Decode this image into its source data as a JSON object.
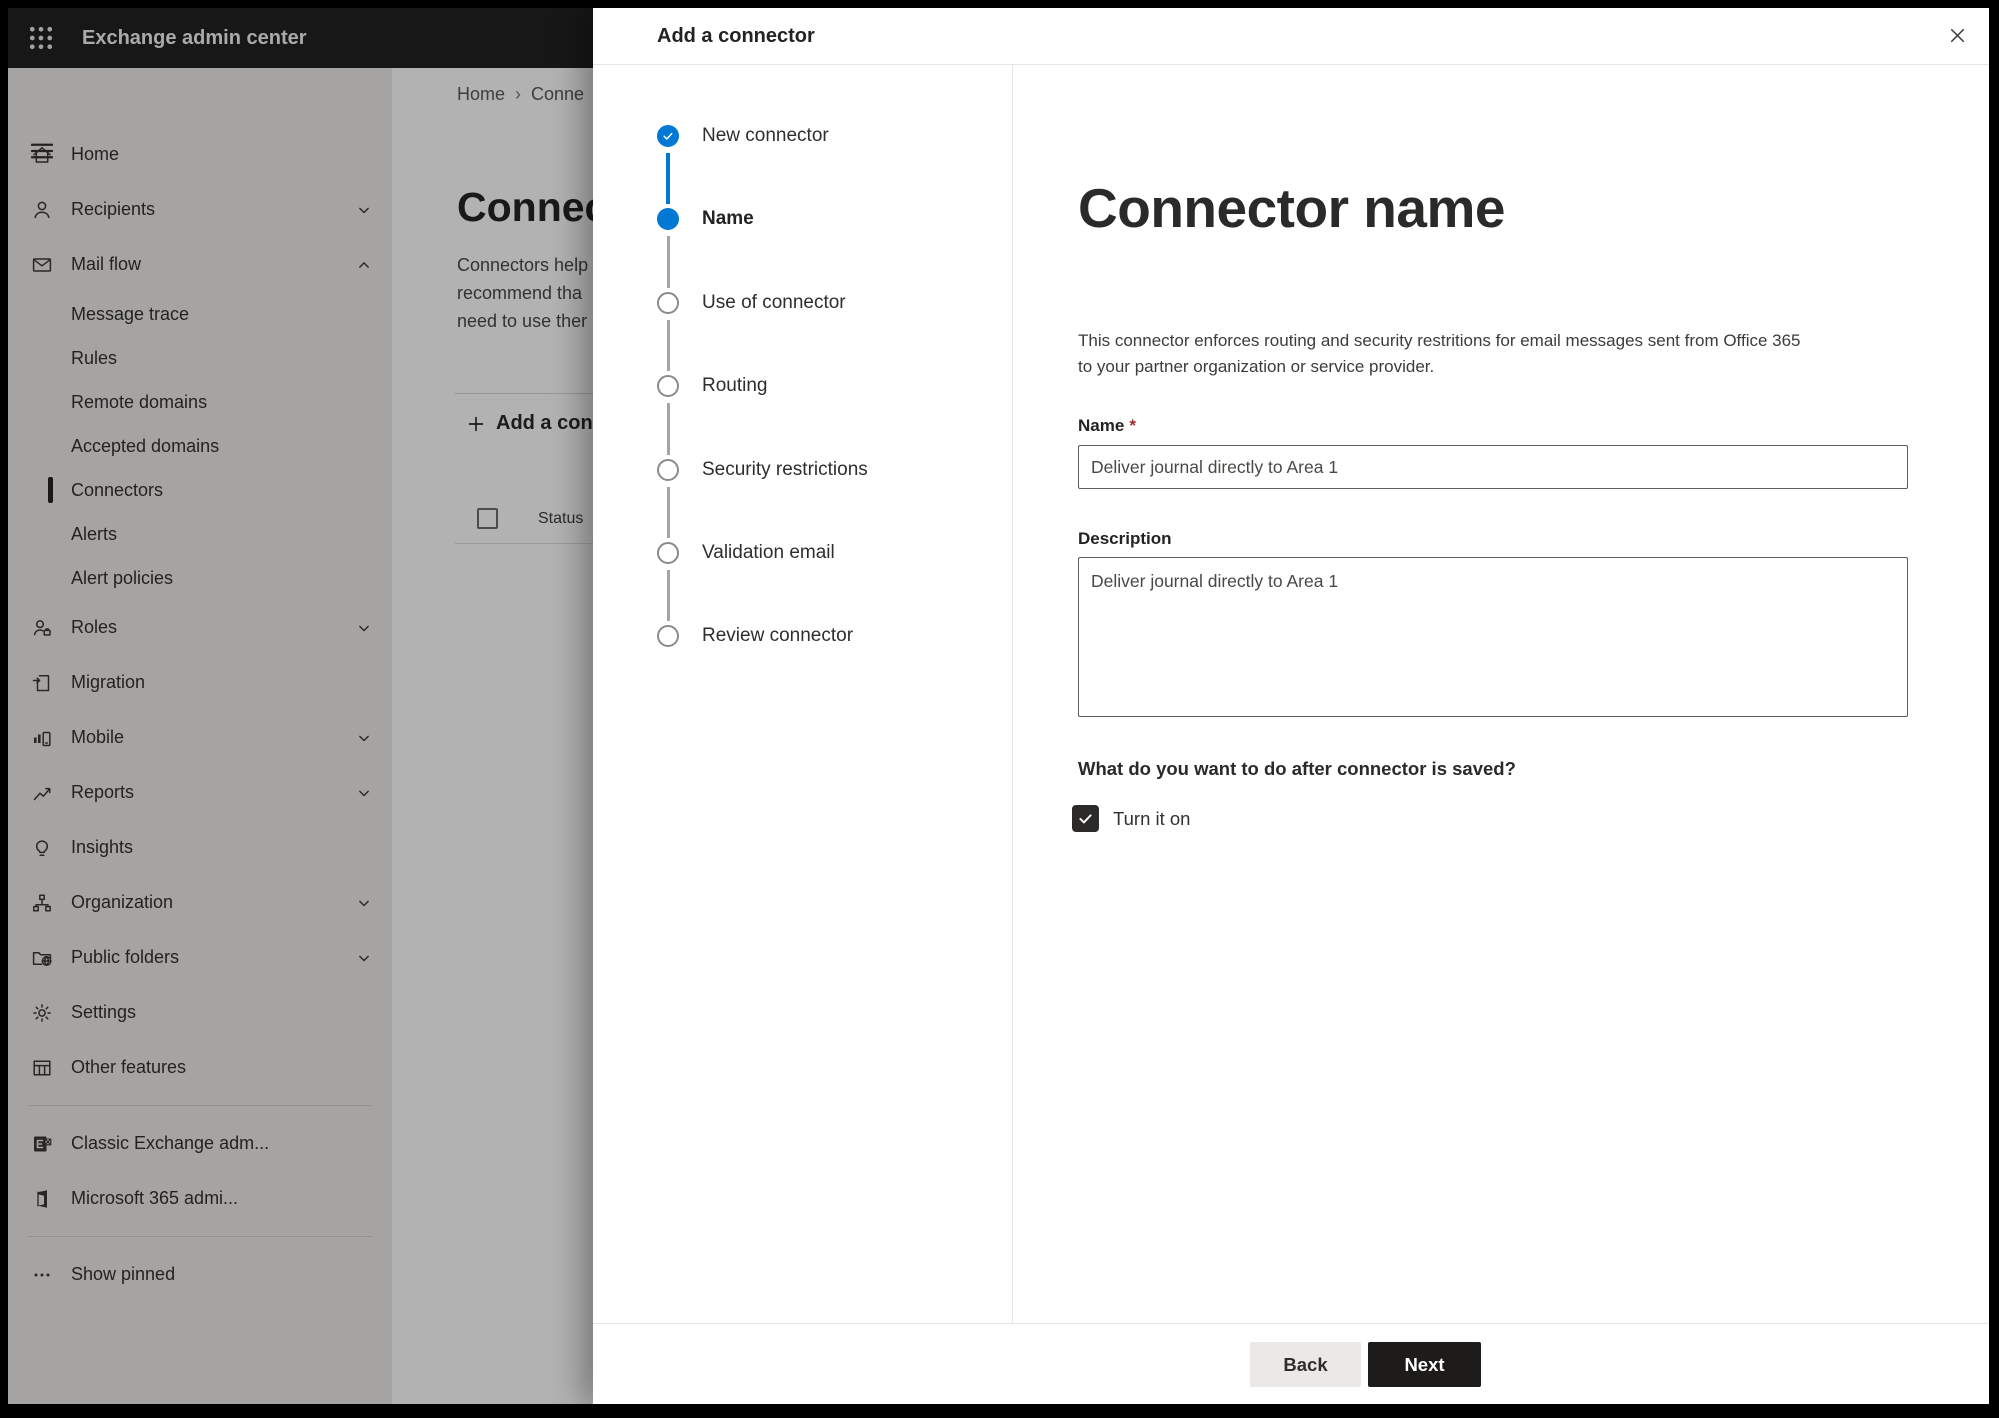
{
  "topbar": {
    "title": "Exchange admin center"
  },
  "sidebar": {
    "items": [
      {
        "label": "Home",
        "icon": "home"
      },
      {
        "label": "Recipients",
        "icon": "person",
        "chevron": "down"
      },
      {
        "label": "Mail flow",
        "icon": "mail",
        "chevron": "up"
      },
      {
        "label": "Message trace",
        "sub": true
      },
      {
        "label": "Rules",
        "sub": true
      },
      {
        "label": "Remote domains",
        "sub": true
      },
      {
        "label": "Accepted domains",
        "sub": true
      },
      {
        "label": "Connectors",
        "sub": true,
        "selected": true
      },
      {
        "label": "Alerts",
        "sub": true
      },
      {
        "label": "Alert policies",
        "sub": true
      },
      {
        "label": "Roles",
        "icon": "roles",
        "chevron": "down"
      },
      {
        "label": "Migration",
        "icon": "migration"
      },
      {
        "label": "Mobile",
        "icon": "mobile",
        "chevron": "down"
      },
      {
        "label": "Reports",
        "icon": "reports",
        "chevron": "down"
      },
      {
        "label": "Insights",
        "icon": "insights"
      },
      {
        "label": "Organization",
        "icon": "organization",
        "chevron": "down"
      },
      {
        "label": "Public folders",
        "icon": "public-folders",
        "chevron": "down"
      },
      {
        "label": "Settings",
        "icon": "settings"
      },
      {
        "label": "Other features",
        "icon": "other-features"
      },
      {
        "divider": true
      },
      {
        "label": "Classic Exchange adm...",
        "icon": "classic-exchange"
      },
      {
        "label": "Microsoft 365 admi...",
        "icon": "m365"
      },
      {
        "divider": true
      },
      {
        "label": "Show pinned",
        "icon": "more"
      }
    ]
  },
  "page": {
    "breadcrumb": {
      "home": "Home",
      "separator": "›",
      "current": "Conne"
    },
    "heading": "Connect",
    "intro_lines": [
      "Connectors help",
      "recommend tha",
      "need to use ther"
    ],
    "add_button": "Add a conn",
    "status_header": "Status"
  },
  "dialog": {
    "title": "Add a connector",
    "steps": [
      {
        "label": "New connector",
        "state": "complete"
      },
      {
        "label": "Name",
        "state": "current"
      },
      {
        "label": "Use of connector",
        "state": "upcoming"
      },
      {
        "label": "Routing",
        "state": "upcoming"
      },
      {
        "label": "Security restrictions",
        "state": "upcoming"
      },
      {
        "label": "Validation email",
        "state": "upcoming"
      },
      {
        "label": "Review connector",
        "state": "upcoming"
      }
    ],
    "content": {
      "heading": "Connector name",
      "description_lines": [
        "This connector enforces routing and security restritions for email messages sent from Office 365",
        "to your partner organization or service provider."
      ],
      "name_label": "Name",
      "required_mark": "*",
      "name_value": "Deliver journal directly to Area 1",
      "description_label": "Description",
      "description_value": "Deliver journal directly to Area 1",
      "after_save_question": "What do you want to do after connector is saved?",
      "turn_on_label": "Turn it on",
      "turn_on_checked": true
    },
    "footer": {
      "back_label": "Back",
      "next_label": "Next"
    }
  },
  "colors": {
    "accent": "#0078d4",
    "step_inactive": "#8d8b89",
    "required_asterisk": "#a4262c",
    "next_button_bg": "#1d1c1b",
    "back_button_bg": "#ebe9e7",
    "topbar_bg": "#212121",
    "overlay": "rgba(0,0,0,0.30)"
  }
}
